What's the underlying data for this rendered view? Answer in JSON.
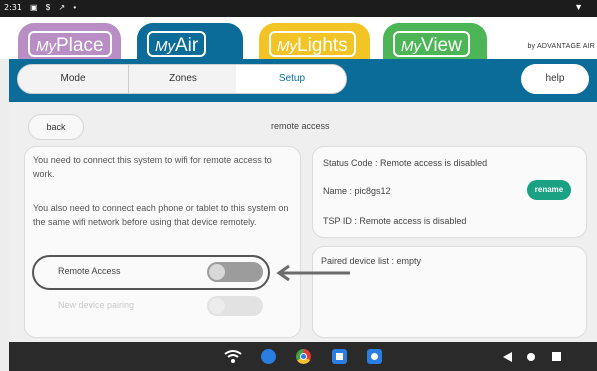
{
  "status_bar": {
    "time": "2:31",
    "left_icons": "▣ $ ↗ •",
    "wifi": "▼"
  },
  "app_tabs": [
    {
      "prefix": "My",
      "name": "Place",
      "color": "#b98ec4"
    },
    {
      "prefix": "My",
      "name": "Air",
      "color": "#0b6c99"
    },
    {
      "prefix": "My",
      "name": "Lights",
      "color": "#f3c425"
    },
    {
      "prefix": "My",
      "name": "View",
      "color": "#4cb657"
    }
  ],
  "brand": "by ADVANTAGE AIR",
  "nav": {
    "tabs": [
      "Mode",
      "Zones",
      "Setup"
    ],
    "active": "Setup",
    "help": "help"
  },
  "page": {
    "back": "back",
    "title": "remote access"
  },
  "left_card": {
    "para1": "You need to connect this system to wifi for remote access to work.",
    "para2": "You also need to connect each phone or tablet to this system on the same wifi network before using that device remotely.",
    "remote_access_label": "Remote Access",
    "new_device_label": "New device pairing"
  },
  "status_card": {
    "status_code": "Status Code : Remote access is disabled",
    "name": "Name : pic8gs12",
    "rename": "rename",
    "tsp_id": "TSP ID : Remote access is disabled"
  },
  "paired_card": {
    "text": "Paired device list : empty"
  },
  "colors": {
    "accent": "#0b6c99",
    "rename": "#1aa184"
  }
}
